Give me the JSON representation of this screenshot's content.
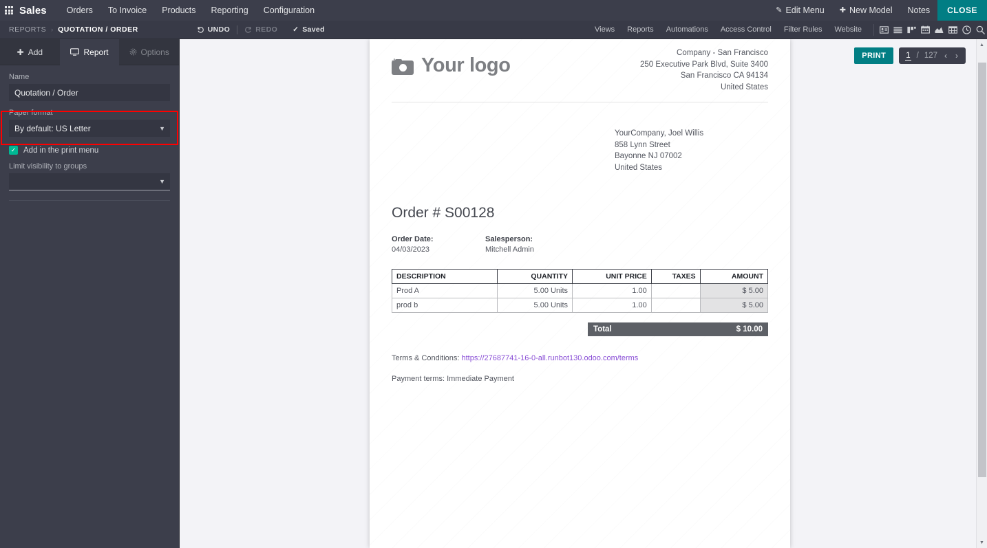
{
  "navbar": {
    "apps_icon": "apps-grid-icon",
    "brand": "Sales",
    "menus": [
      "Orders",
      "To Invoice",
      "Products",
      "Reporting",
      "Configuration"
    ],
    "right": {
      "edit_menu": "Edit Menu",
      "new_model": "New Model",
      "notes": "Notes",
      "close": "CLOSE"
    },
    "accent_close": "#017e84",
    "background": "#3c3e4b"
  },
  "studiobar": {
    "breadcrumb_root": "REPORTS",
    "breadcrumb_sep": "›",
    "breadcrumb_current": "QUOTATION / ORDER",
    "undo": "UNDO",
    "redo": "REDO",
    "saved": "Saved",
    "menus": [
      "Views",
      "Reports",
      "Automations",
      "Access Control",
      "Filter Rules",
      "Website"
    ],
    "view_icons": [
      "kanban-card-icon",
      "list-view-icon",
      "kanban-view-icon",
      "calendar-view-icon",
      "graph-view-icon",
      "pivot-view-icon",
      "activity-view-icon",
      "search-icon"
    ]
  },
  "sidebar": {
    "tabs": [
      {
        "label": "Add",
        "icon": "plus-icon",
        "state": "normal"
      },
      {
        "label": "Report",
        "icon": "monitor-icon",
        "state": "active"
      },
      {
        "label": "Options",
        "icon": "gear-icon",
        "state": "disabled"
      }
    ],
    "name_label": "Name",
    "name_value": "Quotation / Order",
    "name_placeholder": "",
    "paper_format_label": "Paper format",
    "paper_format_value": "By default: US Letter",
    "print_menu_label": "Add in the print menu",
    "print_menu_checked": true,
    "limit_groups_label": "Limit visibility to groups",
    "limit_groups_value": "",
    "highlight_color": "#ff0000"
  },
  "floatbar": {
    "print_label": "PRINT",
    "page_current": "1",
    "page_divider": "/",
    "page_total": "127",
    "prev_icon": "chevron-left-icon",
    "next_icon": "chevron-right-icon"
  },
  "document": {
    "logo_text": "Your logo",
    "logo_icon": "camera-add-icon",
    "company_address": [
      "Company - San Francisco",
      "250 Executive Park Blvd, Suite 3400",
      "San Francisco CA 94134",
      "United States"
    ],
    "customer_address": [
      "YourCompany, Joel Willis",
      "858 Lynn Street",
      "Bayonne NJ 07002",
      "United States"
    ],
    "title": "Order # S00128",
    "meta": [
      {
        "label": "Order Date:",
        "value": "04/03/2023"
      },
      {
        "label": "Salesperson:",
        "value": "Mitchell Admin"
      }
    ],
    "table": {
      "headers": [
        "DESCRIPTION",
        "QUANTITY",
        "UNIT PRICE",
        "TAXES",
        "AMOUNT"
      ],
      "rows": [
        {
          "description": "Prod A",
          "quantity": "5.00 Units",
          "unit_price": "1.00",
          "taxes": "",
          "amount": "$ 5.00"
        },
        {
          "description": "prod b",
          "quantity": "5.00 Units",
          "unit_price": "1.00",
          "taxes": "",
          "amount": "$ 5.00"
        }
      ],
      "total_label": "Total",
      "total_value": "$ 10.00"
    },
    "terms_prefix": "Terms & Conditions: ",
    "terms_link": "https://27687741-16-0-all.runbot130.odoo.com/terms",
    "payment_terms": "Payment terms: Immediate Payment"
  }
}
